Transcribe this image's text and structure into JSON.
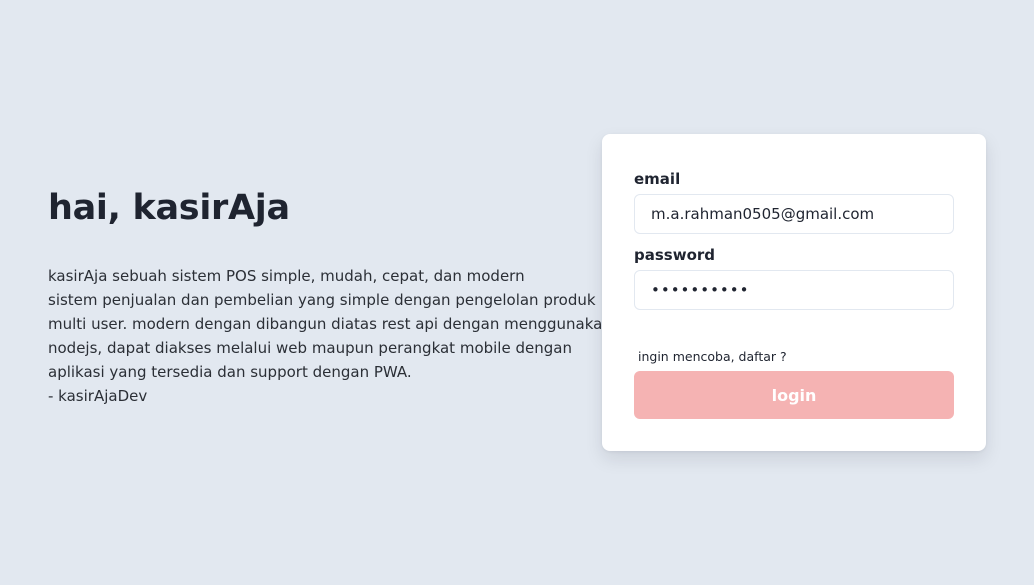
{
  "intro": {
    "title": "hai, kasirAja",
    "lines": [
      "kasirAja sebuah sistem POS simple, mudah, cepat, dan modern",
      "sistem penjualan dan pembelian yang simple dengan pengelolan produk",
      "multi user. modern dengan dibangun diatas rest api dengan menggunakan",
      "nodejs, dapat diakses melalui web maupun perangkat mobile dengan",
      "aplikasi yang tersedia dan support dengan PWA.",
      "- kasirAjaDev"
    ]
  },
  "login_form": {
    "email_label": "email",
    "email_value": "m.a.rahman0505@gmail.com",
    "password_label": "password",
    "password_value": "••••••••••",
    "register_link": "ingin mencoba, daftar ?",
    "login_button": "login"
  },
  "colors": {
    "background": "#e2e8f0",
    "card": "#ffffff",
    "login_button": "#f5b3b3"
  }
}
